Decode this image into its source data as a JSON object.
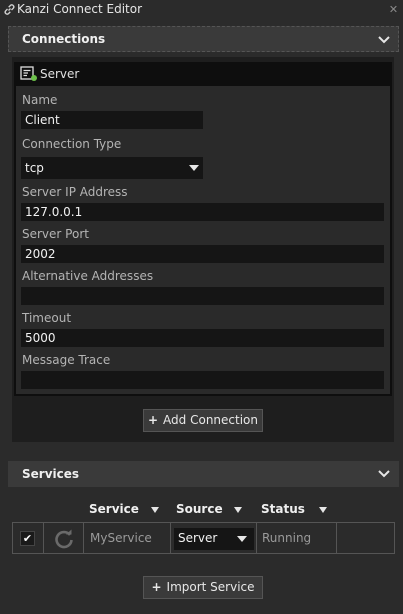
{
  "window": {
    "title": "Kanzi Connect Editor"
  },
  "connections": {
    "title": "Connections",
    "server": {
      "label": "Server",
      "fields": {
        "name_label": "Name",
        "name_value": "Client",
        "type_label": "Connection Type",
        "type_value": "tcp",
        "ip_label": "Server IP Address",
        "ip_value": "127.0.0.1",
        "port_label": "Server Port",
        "port_value": "2002",
        "alt_label": "Alternative Addresses",
        "alt_value": "",
        "timeout_label": "Timeout",
        "timeout_value": "5000",
        "trace_label": "Message Trace",
        "trace_value": ""
      }
    },
    "add_button": "Add Connection"
  },
  "services": {
    "title": "Services",
    "columns": {
      "service": "Service",
      "source": "Source",
      "status": "Status"
    },
    "rows": [
      {
        "checked": true,
        "service": "MyService",
        "source": "Server",
        "status": "Running"
      }
    ],
    "import_button": "Import Service"
  },
  "colors": {
    "accent_green": "#6cc04a",
    "panel": "#2b2b2b",
    "field": "#151515"
  }
}
